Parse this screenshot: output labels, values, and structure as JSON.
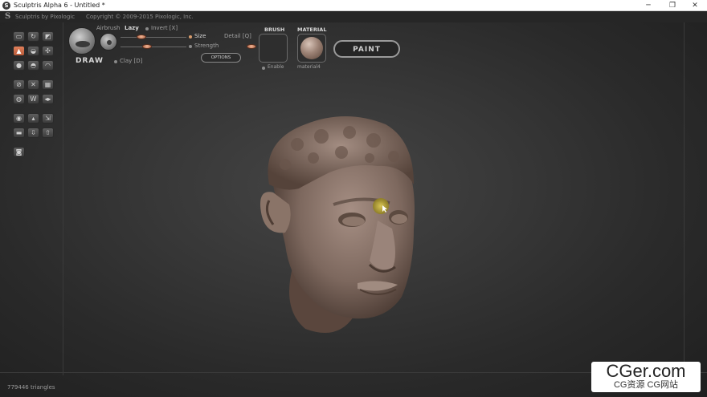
{
  "window": {
    "title": "Sculptris Alpha 6 - Untitled *",
    "minimize": "─",
    "maximize": "❐",
    "close": "✕"
  },
  "brandbar": {
    "brand": "Sculptris by Pixologic",
    "copyright": "Copyright © 2009-2015 Pixologic, Inc."
  },
  "brush": {
    "name": "DRAW",
    "airbrush": "Airbrush",
    "lazy": "Lazy",
    "invert": "Invert [X]",
    "size": "Size",
    "strength": "Strength",
    "detail": "Detail [Q]",
    "clay": "Clay [D]",
    "options": "OPTIONS"
  },
  "brush_panel": {
    "title": "BRUSH",
    "enable": "Enable"
  },
  "material_panel": {
    "title": "MATERIAL",
    "name": "material4"
  },
  "paint_button": "PAINT",
  "status": {
    "triangles": "779446 triangles"
  },
  "watermark": {
    "line1": "CGer.com",
    "line2": "CG资源 CG网站"
  },
  "tools": [
    {
      "icon": "flatten-icon"
    },
    {
      "icon": "rotate-icon"
    },
    {
      "icon": "crease-icon"
    },
    {
      "icon": "draw-icon"
    },
    {
      "icon": "inflate-icon"
    },
    {
      "icon": "pinch-icon"
    },
    {
      "icon": "grab-icon"
    },
    {
      "icon": "smooth-icon"
    },
    {
      "icon": "flatten-alt-icon"
    },
    {
      "icon": "scale-icon"
    },
    {
      "icon": "mask-icon"
    },
    {
      "icon": "reduce-icon"
    },
    {
      "icon": "subdivide-icon"
    },
    {
      "icon": "symmetry-icon"
    },
    {
      "icon": "wireframe-icon"
    },
    {
      "icon": "sphere-icon"
    },
    {
      "icon": "plane-icon"
    },
    {
      "icon": "import-icon"
    },
    {
      "icon": "export-icon"
    },
    {
      "icon": "save-icon"
    },
    {
      "icon": "open-icon"
    },
    {
      "icon": "camera-icon"
    }
  ],
  "colors": {
    "accent": "#d87a52",
    "cursor": "#c8b43a"
  }
}
